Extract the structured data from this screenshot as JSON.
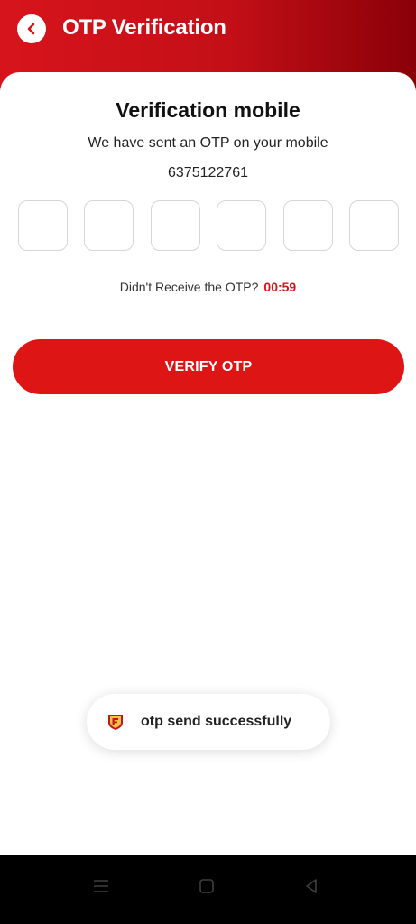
{
  "header": {
    "title": "OTP Verification",
    "back_icon": "chevron-left-icon",
    "gradient_start": "#d7141b",
    "gradient_end": "#8a0008"
  },
  "verification": {
    "title": "Verification mobile",
    "subtitle": "We have sent an OTP on your mobile",
    "phone": "6375122761",
    "otp_boxes": [
      "",
      "",
      "",
      "",
      "",
      ""
    ],
    "resend_text": "Didn't Receive the OTP?",
    "timer": "00:59",
    "button_label": "VERIFY OTP"
  },
  "toast": {
    "message": "otp send successfully",
    "logo_icon": "app-logo-icon"
  },
  "navbar": {
    "icons": [
      "menu-icon",
      "home-square-icon",
      "back-triangle-icon"
    ]
  },
  "colors": {
    "accent": "#de1515",
    "timer": "#d8131b",
    "navbar": "#000000"
  }
}
